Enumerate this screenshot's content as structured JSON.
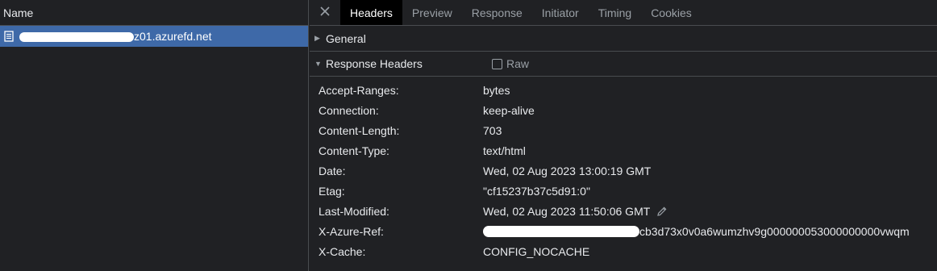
{
  "left": {
    "column_header": "Name",
    "request": {
      "name_suffix": "z01.azurefd.net"
    }
  },
  "tabs": [
    {
      "label": "Headers",
      "active": true
    },
    {
      "label": "Preview",
      "active": false
    },
    {
      "label": "Response",
      "active": false
    },
    {
      "label": "Initiator",
      "active": false
    },
    {
      "label": "Timing",
      "active": false
    },
    {
      "label": "Cookies",
      "active": false
    }
  ],
  "sections": {
    "general": {
      "label": "General",
      "expanded": false
    },
    "response_headers": {
      "label": "Response Headers",
      "expanded": true,
      "raw_label": "Raw"
    }
  },
  "headers": [
    {
      "key": "Accept-Ranges:",
      "value": "bytes"
    },
    {
      "key": "Connection:",
      "value": "keep-alive"
    },
    {
      "key": "Content-Length:",
      "value": "703"
    },
    {
      "key": "Content-Type:",
      "value": "text/html"
    },
    {
      "key": "Date:",
      "value": "Wed, 02 Aug 2023 13:00:19 GMT"
    },
    {
      "key": "Etag:",
      "value": "\"cf15237b37c5d91:0\""
    },
    {
      "key": "Last-Modified:",
      "value": "Wed, 02 Aug 2023 11:50:06 GMT"
    },
    {
      "key": "X-Azure-Ref:",
      "value": "cb3d73x0v0a6wumzhv9g000000053000000000vwqm"
    },
    {
      "key": "X-Cache:",
      "value": "CONFIG_NOCACHE"
    }
  ],
  "colors": {
    "selected_row": "#3e69a8",
    "background": "#202124",
    "active_tab": "#000000",
    "border": "#494c50"
  },
  "icons": {
    "request": "document-icon",
    "close": "close-icon",
    "edit": "pencil-icon"
  }
}
